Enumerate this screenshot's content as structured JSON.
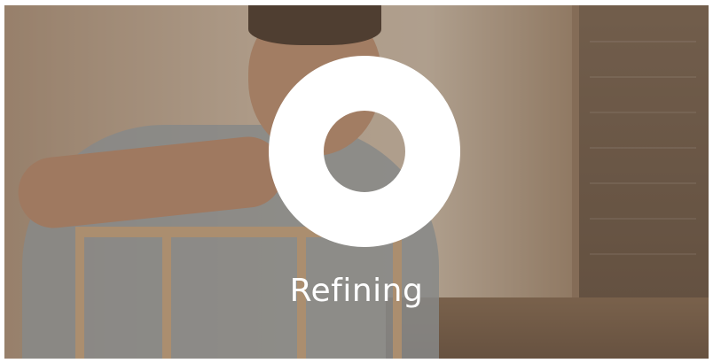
{
  "card": {
    "label": "Refining",
    "icon": "ring-icon",
    "overlay_color": "#786454",
    "text_color": "#ffffff"
  }
}
